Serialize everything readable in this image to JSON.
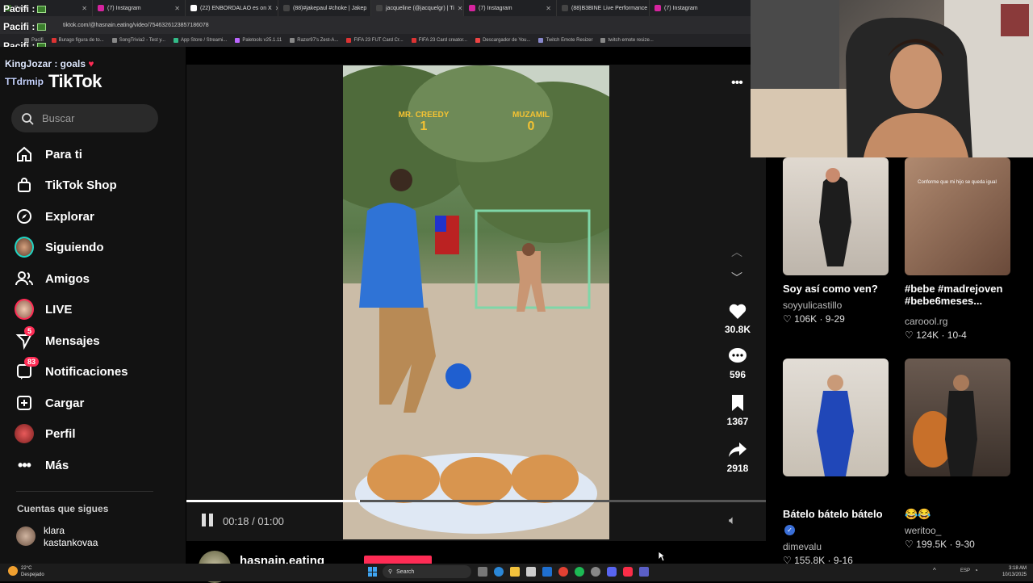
{
  "browser": {
    "tabs": [
      {
        "title": "Pacifi",
        "color": "#3a7d2c"
      },
      {
        "title": "(7) Instagram",
        "color": "#d6249f"
      },
      {
        "title": "(22) ENBORDALAO es on X",
        "color": "#ffffff"
      },
      {
        "title": "(88)#jakepaul #choke | Jakep",
        "color": "#111111"
      },
      {
        "title": "jacqueline (@jacquelgr) | Ti",
        "color": "#111111"
      },
      {
        "title": "(7) Instagram",
        "color": "#d6249f"
      },
      {
        "title": "(88)B3BINE Live Performance",
        "color": "#111111"
      },
      {
        "title": "(7) Instagram",
        "color": "#d6249f"
      }
    ],
    "url": "tiktok.com/@hasnain.eating/video/7546326123857186078",
    "bookmarks": [
      "Pacifi",
      "Burago figura de to...",
      "SongTrivia2 - Test y...",
      "App Store / Streami...",
      "Paletools v25.1.11",
      "Razor97's Zest-A...",
      "FIFA 23 FUT Card Cr...",
      "FIFA 23 Card creator...",
      "Descargador de You...",
      "Twitch Emote Resizer",
      "twitch emote resize..."
    ]
  },
  "overlay": {
    "line1": "Pacifi :",
    "line2": "Pacifi :",
    "line3": "Pacifi :",
    "chat": "KingJozar : goals",
    "heart": "♥",
    "chat2": "TTdrmip"
  },
  "app": {
    "logo": "TikTok"
  },
  "search": {
    "placeholder": "Buscar"
  },
  "nav": [
    {
      "label": "Para ti",
      "icon": "home-icon"
    },
    {
      "label": "TikTok Shop",
      "icon": "shop-icon"
    },
    {
      "label": "Explorar",
      "icon": "compass-icon"
    },
    {
      "label": "Siguiendo",
      "icon": "following-avatar-icon"
    },
    {
      "label": "Amigos",
      "icon": "friends-icon"
    },
    {
      "label": "LIVE",
      "icon": "live-icon"
    },
    {
      "label": "Mensajes",
      "icon": "messages-icon",
      "badge": "5"
    },
    {
      "label": "Notificaciones",
      "icon": "notifications-icon",
      "badge": "83"
    },
    {
      "label": "Cargar",
      "icon": "upload-icon"
    },
    {
      "label": "Perfil",
      "icon": "profile-icon"
    },
    {
      "label": "Más",
      "icon": "more-icon"
    }
  ],
  "following": {
    "heading": "Cuentas que sigues",
    "accounts": [
      {
        "name": "klara",
        "handle": "kastankovaa"
      }
    ]
  },
  "video": {
    "score_left_name": "MR. CREEDY",
    "score_left": "1",
    "score_right_name": "MUZAMIL",
    "score_right": "0",
    "time": "00:18 / 01:00",
    "progress": 0.3,
    "author": "hasnain.eating"
  },
  "actions": {
    "likes": "30.8K",
    "comments": "596",
    "saves": "1367",
    "shares": "2918"
  },
  "recommended": [
    {
      "title": "Soy así como ven?",
      "author": "soyyulicastillo",
      "likes": "106K",
      "date": "9-29",
      "color": "#cfc8bf"
    },
    {
      "title": "#bebe #madrejoven #bebe6meses...",
      "author": "caroool.rg",
      "likes": "124K",
      "date": "10-4",
      "color": "#b08a70",
      "caption": "Conforme que mi hijo se queda igual"
    },
    {
      "title": "Bátelo bátelo bátelo",
      "author": "dimevalu",
      "likes": "155.8K",
      "date": "9-16",
      "color": "#d9d2c8"
    },
    {
      "title": "😂😂",
      "author": "weritoo_",
      "likes": "199.5K",
      "date": "9-30",
      "color": "#5b4d45"
    }
  ],
  "taskbar": {
    "weather_temp": "22°C",
    "weather_desc": "Despejado",
    "search": "Search",
    "lang": "ESP",
    "time": "3:18 AM",
    "date": "10/13/2025"
  },
  "colors": {
    "accent": "#fe2c55",
    "sidebar_bg": "#121212",
    "player_bg": "#161616"
  }
}
